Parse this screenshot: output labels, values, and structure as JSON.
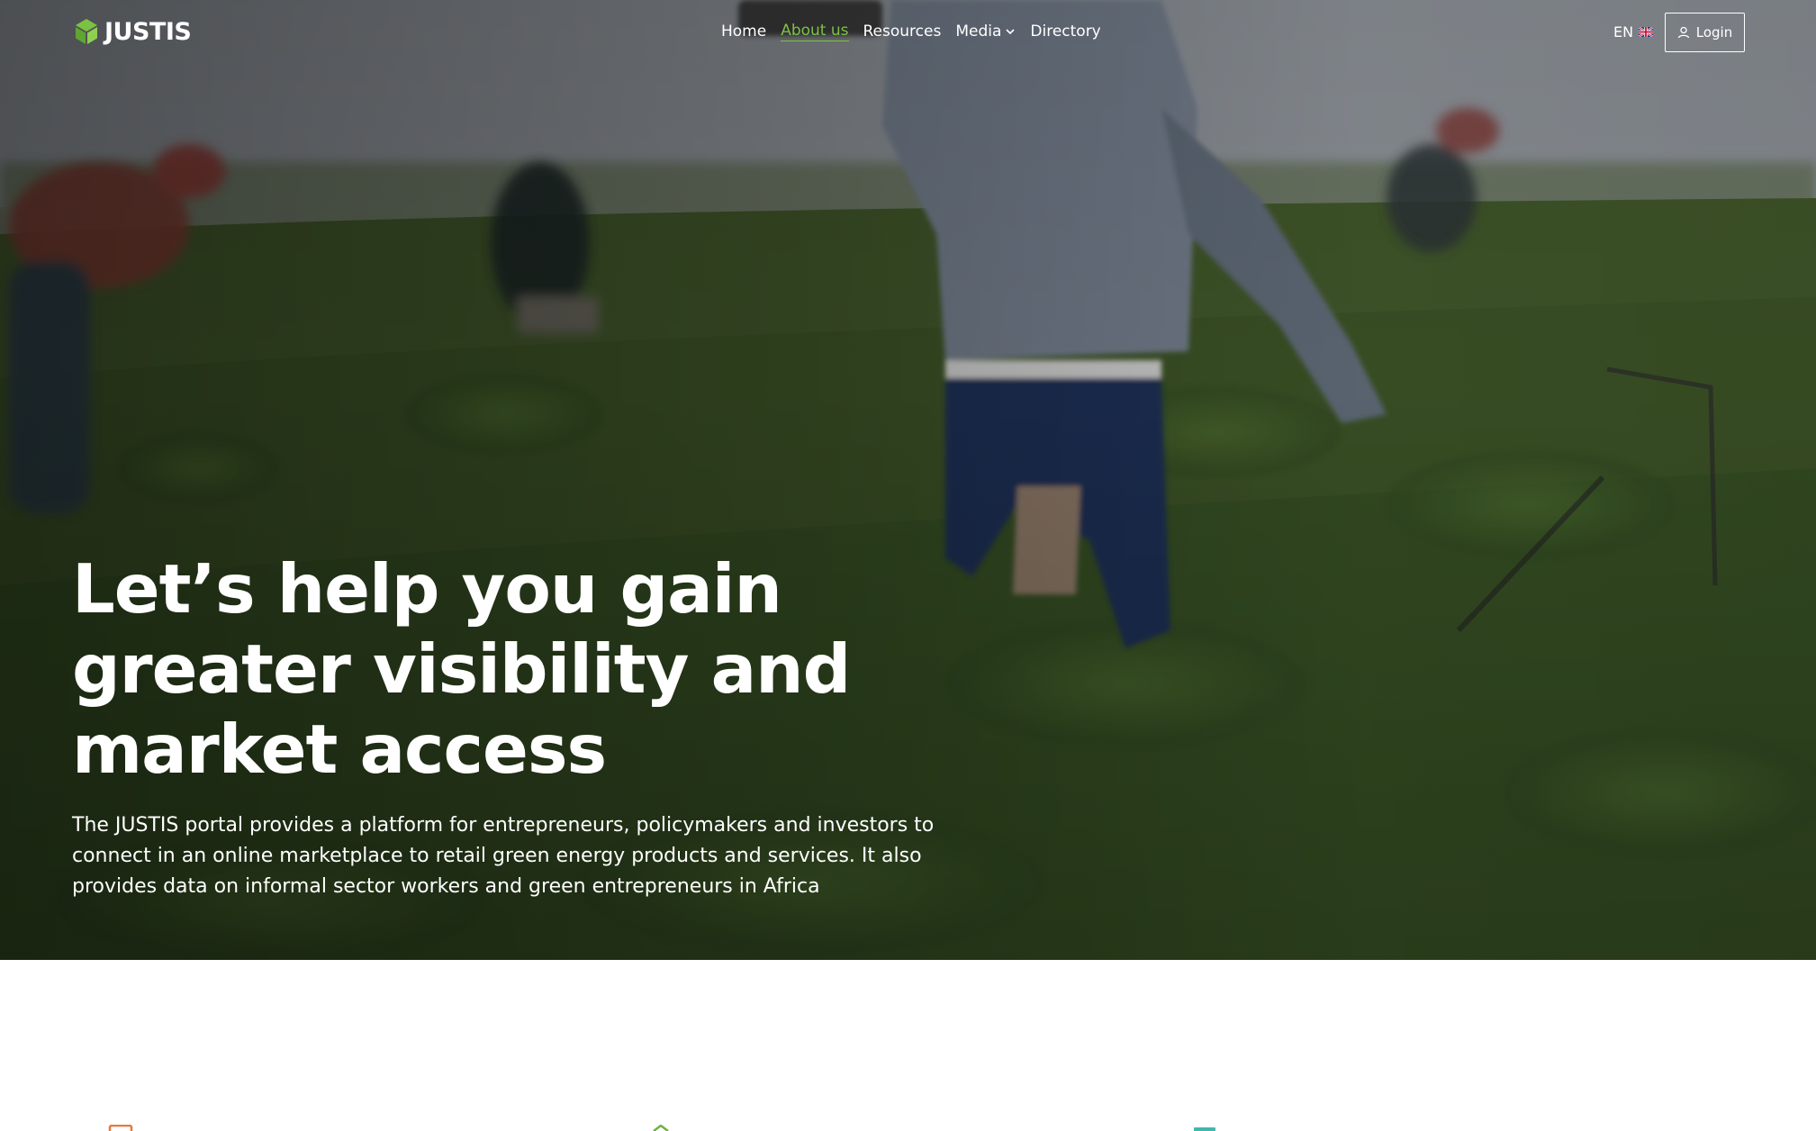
{
  "brand": {
    "name": "JUSTIS",
    "logo_icon": "leaf-cube-icon",
    "accent_color": "#7cc242"
  },
  "nav": {
    "items": [
      {
        "label": "Home",
        "active": false
      },
      {
        "label": "About us",
        "active": true
      },
      {
        "label": "Resources",
        "active": false
      },
      {
        "label": "Media",
        "active": false,
        "has_dropdown": true
      },
      {
        "label": "Directory",
        "active": false
      }
    ],
    "language": {
      "code": "EN",
      "flag_icon": "uk-flag-icon"
    },
    "login_label": "Login",
    "login_icon": "user-icon"
  },
  "hero": {
    "headline": "Let’s help you gain greater visibility and market access",
    "subtext": "The JUSTIS portal provides a platform for entrepreneurs, policymakers and investors to connect in an online marketplace to retail green energy products and services. It also provides data on informal sector workers and green entrepreneurs in Africa"
  },
  "features": {
    "icons": [
      {
        "name": "orange-feature-icon",
        "color": "#e8793a"
      },
      {
        "name": "green-feature-icon",
        "color": "#6db33f"
      },
      {
        "name": "teal-feature-icon",
        "color": "#3fb8b0"
      }
    ]
  }
}
